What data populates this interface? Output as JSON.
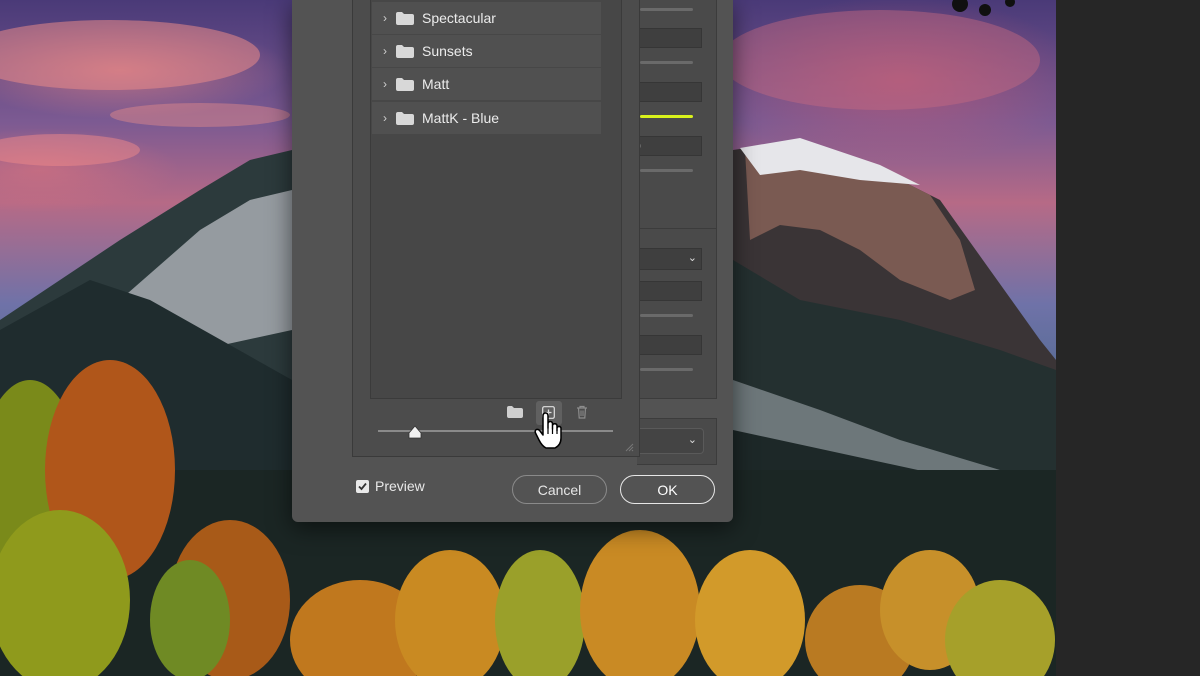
{
  "preset_folders": [
    {
      "label": "Spectacular"
    },
    {
      "label": "Sunsets"
    },
    {
      "label": "Matt"
    },
    {
      "label": "MattK - Blue"
    }
  ],
  "toolbar": {
    "new_group_icon": "folder-icon",
    "new_preset_icon": "plus-square-icon",
    "delete_icon": "trash-icon"
  },
  "right_panel": {
    "partial_value_text": ")"
  },
  "footer": {
    "preview_label": "Preview",
    "preview_checked": true,
    "cancel_label": "Cancel",
    "ok_label": "OK"
  },
  "colors": {
    "accent_slider": "#d9f21c"
  }
}
